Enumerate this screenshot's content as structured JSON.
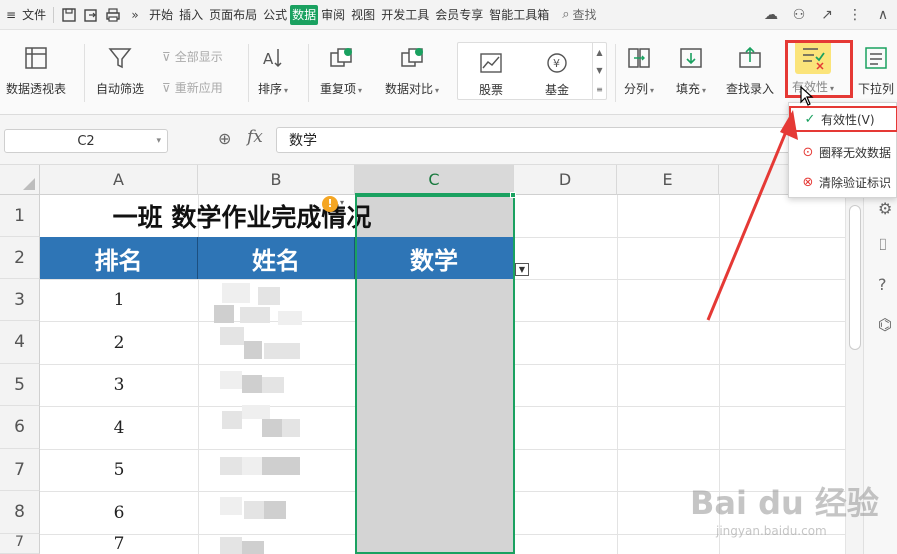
{
  "menubar": {
    "file": "文件",
    "tabs": [
      "开始",
      "插入",
      "页面布局",
      "公式",
      "数据",
      "审阅",
      "视图",
      "开发工具",
      "会员专享",
      "智能工具箱"
    ],
    "active_tab": "数据",
    "search": "查找"
  },
  "ribbon": {
    "pivot": "数据透视表",
    "autofilter": "自动筛选",
    "show_all": "全部显示",
    "reapply": "重新应用",
    "sort": "排序",
    "duplicates": "重复项",
    "compare": "数据对比",
    "stocks": "股票",
    "funds": "基金",
    "split": "分列",
    "fill": "填充",
    "lookup": "查找录入",
    "validity": "有效性",
    "dropdown_list": "下拉列"
  },
  "formula": {
    "cell_ref": "C2",
    "fx": "fx",
    "content": "数学"
  },
  "grid": {
    "columns": [
      "A",
      "B",
      "C",
      "D",
      "E"
    ],
    "rows": [
      "1",
      "2",
      "3",
      "4",
      "5",
      "6",
      "7",
      "8"
    ],
    "title": "一班 数学作业完成情况",
    "headers": [
      "排名",
      "姓名",
      "数学"
    ],
    "ranks": [
      "1",
      "2",
      "3",
      "4",
      "5",
      "6",
      "7"
    ]
  },
  "validity_menu": {
    "items": [
      "有效性(V)",
      "圈释无效数据",
      "清除验证标识"
    ]
  },
  "watermark": {
    "main": "Bai du 经验",
    "sub": "jingyan.baidu.com"
  },
  "colors": {
    "accent": "#1aa160",
    "header_fill": "#2e75b6",
    "highlight": "#e53935"
  }
}
